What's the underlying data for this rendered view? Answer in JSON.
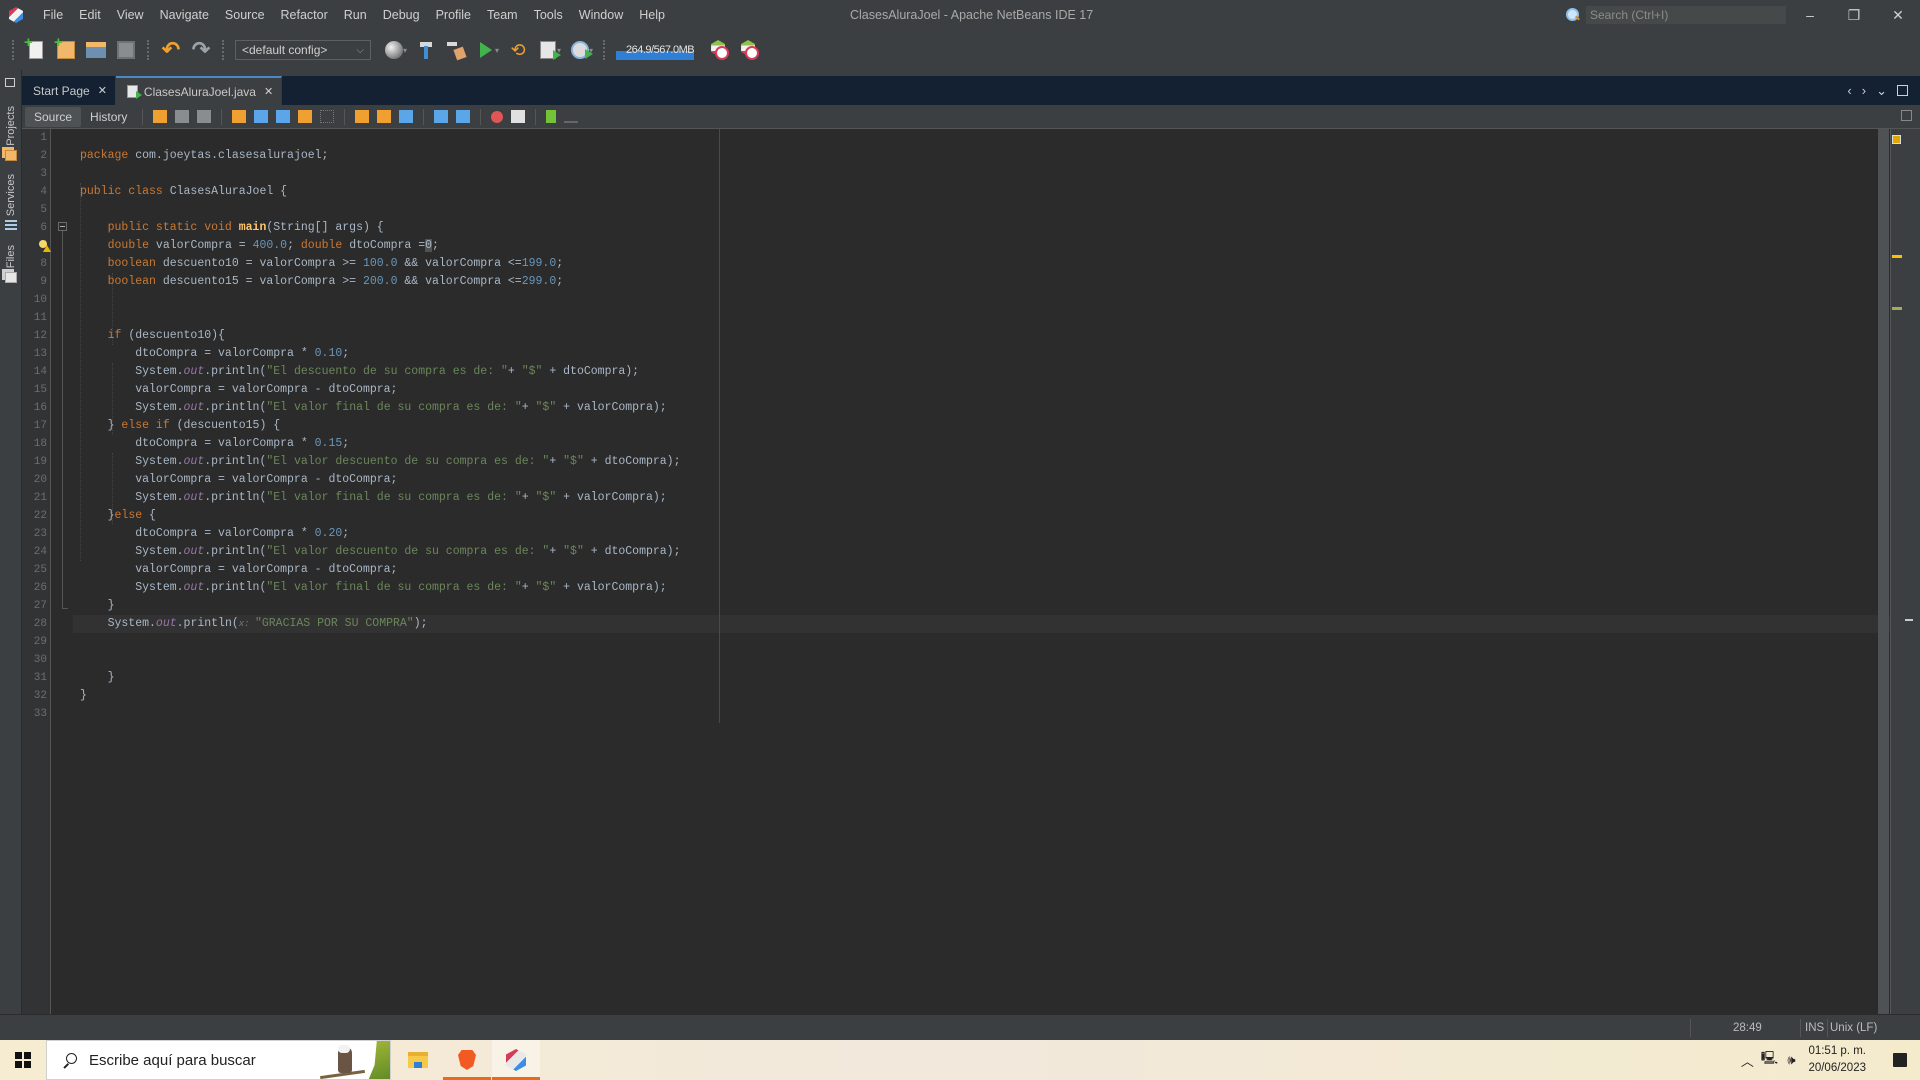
{
  "window": {
    "title": "ClasesAluraJoel - Apache NetBeans IDE 17",
    "controls": {
      "minimize": "–",
      "restore": "❐",
      "close": "✕"
    }
  },
  "menu": [
    "File",
    "Edit",
    "View",
    "Navigate",
    "Source",
    "Refactor",
    "Run",
    "Debug",
    "Profile",
    "Team",
    "Tools",
    "Window",
    "Help"
  ],
  "search": {
    "placeholder": "Search (Ctrl+I)",
    "value": ""
  },
  "toolbar": {
    "config": "<default config>",
    "memory": {
      "text": "264.9/567.0MB",
      "used_mb": 264.9,
      "total_mb": 567.0
    },
    "icons": [
      "new-file-icon",
      "new-project-icon",
      "open-project-icon",
      "save-all-icon",
      "undo-icon",
      "redo-icon",
      "browser-icon",
      "build-icon",
      "clean-build-icon",
      "run-icon",
      "debug-icon",
      "profile-icon",
      "gauge-icon",
      "gc-icon",
      "profiler-snapshot-icon"
    ]
  },
  "side_panels": [
    "Projects",
    "Services",
    "Files"
  ],
  "tabs": [
    {
      "label": "Start Page",
      "active": false
    },
    {
      "label": "ClasesAluraJoel.java",
      "active": true
    }
  ],
  "editor_toolbar": {
    "source_label": "Source",
    "history_label": "History"
  },
  "editor": {
    "line_numbers": [
      "1",
      "2",
      "3",
      "4",
      "5",
      "6",
      "7",
      "8",
      "9",
      "10",
      "11",
      "12",
      "13",
      "14",
      "15",
      "16",
      "17",
      "18",
      "19",
      "20",
      "21",
      "22",
      "23",
      "24",
      "25",
      "26",
      "27",
      "28",
      "29",
      "30",
      "31",
      "32",
      "33"
    ],
    "current_line": 28,
    "lines": [
      [],
      [
        [
          "kw",
          "package"
        ],
        [
          "t",
          " com.joeytas.clasesalurajoel;"
        ]
      ],
      [],
      [
        [
          "kw",
          "public class"
        ],
        [
          "t",
          " ClasesAluraJoel {"
        ]
      ],
      [],
      [
        [
          "t",
          "    "
        ],
        [
          "kw",
          "public static void"
        ],
        [
          "t",
          " "
        ],
        [
          "mth",
          "main"
        ],
        [
          "t",
          "(String[] args) {"
        ]
      ],
      [
        [
          "t",
          "    "
        ],
        [
          "kw",
          "double"
        ],
        [
          "t",
          " valorCompra = "
        ],
        [
          "num",
          "400.0"
        ],
        [
          "t",
          "; "
        ],
        [
          "kw",
          "double"
        ],
        [
          "t",
          " dtoCompra ="
        ],
        [
          "caret",
          "0"
        ],
        [
          "t",
          ";"
        ]
      ],
      [
        [
          "t",
          "    "
        ],
        [
          "kw",
          "boolean"
        ],
        [
          "t",
          " descuento10 = valorCompra >= "
        ],
        [
          "num",
          "100.0"
        ],
        [
          "t",
          " && valorCompra <="
        ],
        [
          "num",
          "199.0"
        ],
        [
          "t",
          ";"
        ]
      ],
      [
        [
          "t",
          "    "
        ],
        [
          "kw",
          "boolean"
        ],
        [
          "t",
          " descuento15 = valorCompra >= "
        ],
        [
          "num",
          "200.0"
        ],
        [
          "t",
          " && valorCompra <="
        ],
        [
          "num",
          "299.0"
        ],
        [
          "t",
          ";"
        ]
      ],
      [],
      [],
      [
        [
          "t",
          "    "
        ],
        [
          "kw",
          "if"
        ],
        [
          "t",
          " (descuento10){"
        ]
      ],
      [
        [
          "t",
          "        dtoCompra = valorCompra * "
        ],
        [
          "num",
          "0.10"
        ],
        [
          "t",
          ";"
        ]
      ],
      [
        [
          "t",
          "        System."
        ],
        [
          "fld",
          "out"
        ],
        [
          "t",
          ".println("
        ],
        [
          "str",
          "\"El descuento de su compra es de: \""
        ],
        [
          "t",
          "+ "
        ],
        [
          "str",
          "\"$\""
        ],
        [
          "t",
          " + dtoCompra);"
        ]
      ],
      [
        [
          "t",
          "        valorCompra = valorCompra - dtoCompra;"
        ]
      ],
      [
        [
          "t",
          "        System."
        ],
        [
          "fld",
          "out"
        ],
        [
          "t",
          ".println("
        ],
        [
          "str",
          "\"El valor final de su compra es de: \""
        ],
        [
          "t",
          "+ "
        ],
        [
          "str",
          "\"$\""
        ],
        [
          "t",
          " + valorCompra);"
        ]
      ],
      [
        [
          "t",
          "    } "
        ],
        [
          "kw",
          "else if"
        ],
        [
          "t",
          " (descuento15) {"
        ]
      ],
      [
        [
          "t",
          "        dtoCompra = valorCompra * "
        ],
        [
          "num",
          "0.15"
        ],
        [
          "t",
          ";"
        ]
      ],
      [
        [
          "t",
          "        System."
        ],
        [
          "fld",
          "out"
        ],
        [
          "t",
          ".println("
        ],
        [
          "str",
          "\"El valor descuento de su compra es de: \""
        ],
        [
          "t",
          "+ "
        ],
        [
          "str",
          "\"$\""
        ],
        [
          "t",
          " + dtoCompra);"
        ]
      ],
      [
        [
          "t",
          "        valorCompra = valorCompra - dtoCompra;"
        ]
      ],
      [
        [
          "t",
          "        System."
        ],
        [
          "fld",
          "out"
        ],
        [
          "t",
          ".println("
        ],
        [
          "str",
          "\"El valor final de su compra es de: \""
        ],
        [
          "t",
          "+ "
        ],
        [
          "str",
          "\"$\""
        ],
        [
          "t",
          " + valorCompra);"
        ]
      ],
      [
        [
          "t",
          "    }"
        ],
        [
          "kw",
          "else"
        ],
        [
          "t",
          " {"
        ]
      ],
      [
        [
          "t",
          "        dtoCompra = valorCompra * "
        ],
        [
          "num",
          "0.20"
        ],
        [
          "t",
          ";"
        ]
      ],
      [
        [
          "t",
          "        System."
        ],
        [
          "fld",
          "out"
        ],
        [
          "t",
          ".println("
        ],
        [
          "str",
          "\"El valor descuento de su compra es de: \""
        ],
        [
          "t",
          "+ "
        ],
        [
          "str",
          "\"$\""
        ],
        [
          "t",
          " + dtoCompra);"
        ]
      ],
      [
        [
          "t",
          "        valorCompra = valorCompra - dtoCompra;"
        ]
      ],
      [
        [
          "t",
          "        System."
        ],
        [
          "fld",
          "out"
        ],
        [
          "t",
          ".println("
        ],
        [
          "str",
          "\"El valor final de su compra es de: \""
        ],
        [
          "t",
          "+ "
        ],
        [
          "str",
          "\"$\""
        ],
        [
          "t",
          " + valorCompra);"
        ]
      ],
      [
        [
          "t",
          "    }"
        ]
      ],
      [
        [
          "t",
          "    System."
        ],
        [
          "fld",
          "out"
        ],
        [
          "t",
          ".println("
        ],
        [
          "hint",
          "x: "
        ],
        [
          "str",
          "\"GRACIAS POR SU COMPRA\""
        ],
        [
          "t",
          ");"
        ]
      ],
      [],
      [],
      [
        [
          "t",
          "    }"
        ]
      ],
      [
        [
          "t",
          "}"
        ]
      ],
      []
    ]
  },
  "statusbar": {
    "position": "28:49",
    "mode": "INS",
    "line_ending": "Unix (LF)"
  },
  "taskbar": {
    "search_placeholder": "Escribe aquí para buscar",
    "apps": [
      "file-explorer",
      "brave-browser",
      "netbeans"
    ],
    "time": "01:51 p. m.",
    "date": "20/06/2023"
  }
}
